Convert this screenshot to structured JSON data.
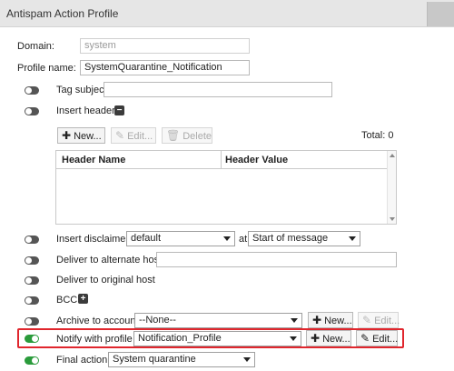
{
  "window": {
    "title": "Antispam Action Profile"
  },
  "domain": {
    "label": "Domain:",
    "value": "system"
  },
  "profile_name": {
    "label": "Profile name:",
    "value": "SystemQuarantine_Notification"
  },
  "tag_subject": {
    "label": "Tag subject",
    "value": "",
    "enabled": false
  },
  "insert_header": {
    "label": "Insert header",
    "enabled": false,
    "toolbar": {
      "new": "New...",
      "edit": "Edit...",
      "delete": "Delete",
      "total": "Total: 0"
    },
    "columns": [
      "Header Name",
      "Header Value"
    ],
    "rows": []
  },
  "insert_disclaimer": {
    "label": "Insert disclaimer",
    "value": "default",
    "at_label": "at",
    "position_value": "Start of message",
    "enabled": false
  },
  "deliver_alternate": {
    "label": "Deliver to alternate host",
    "value": "",
    "enabled": false
  },
  "deliver_original": {
    "label": "Deliver to original host",
    "enabled": false
  },
  "bcc": {
    "label": "BCC",
    "enabled": false
  },
  "archive": {
    "label": "Archive to account",
    "value": "--None--",
    "new": "New...",
    "edit": "Edit...",
    "enabled": false
  },
  "notify": {
    "label": "Notify with profile",
    "value": "Notification_Profile",
    "new": "New...",
    "edit": "Edit...",
    "enabled": true
  },
  "final_action": {
    "label": "Final action:",
    "value": "System quarantine",
    "enabled": true
  }
}
